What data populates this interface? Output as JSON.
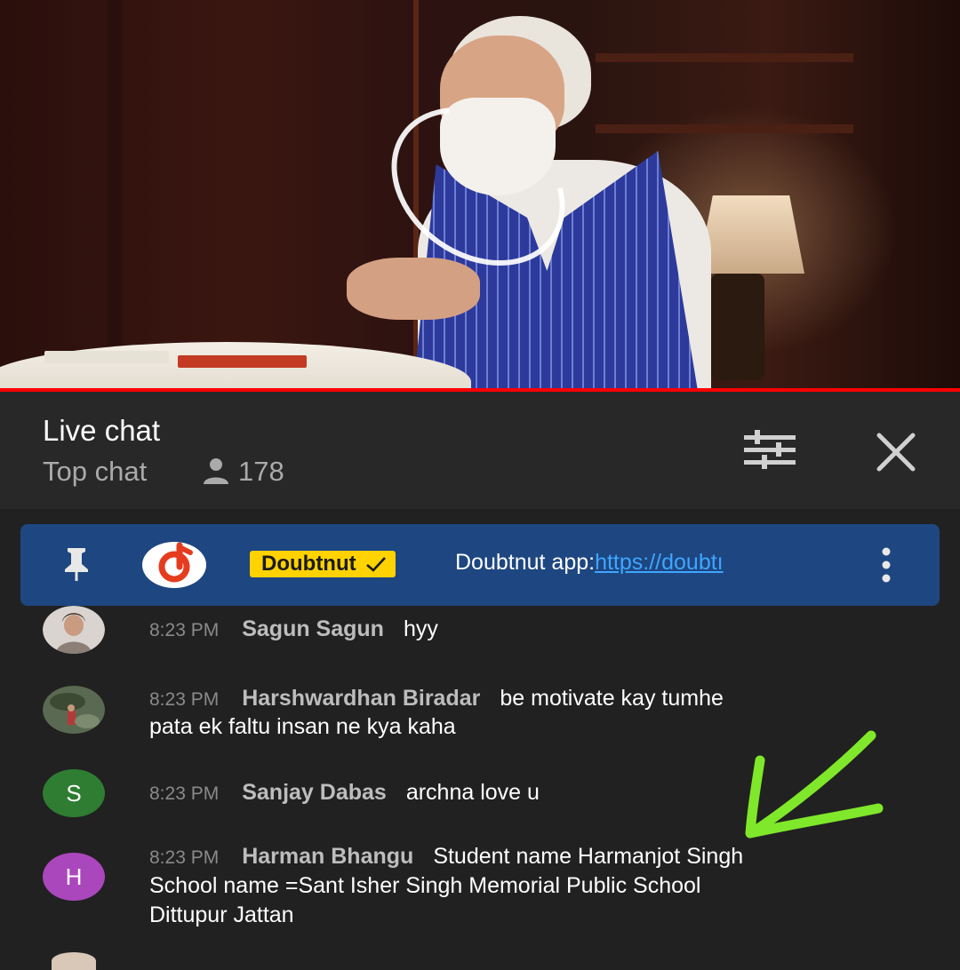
{
  "chat": {
    "title": "Live chat",
    "mode": "Top chat",
    "viewer_count": "178"
  },
  "pinned": {
    "author": "Doubtnut",
    "text_prefix": "Doubtnut app:",
    "link_text": "https://doubtı"
  },
  "messages": [
    {
      "time": "8:23 PM",
      "author": "Sagun Sagun",
      "text": "hyy",
      "avatar_letter": "",
      "avatar_color": "#d9d4cf"
    },
    {
      "time": "8:23 PM",
      "author": "Harshwardhan Biradar",
      "text": "be motivate kay tumhe",
      "text2": "pata ek faltu insan ne kya kaha",
      "avatar_letter": "",
      "avatar_color": "#5a6a52"
    },
    {
      "time": "8:23 PM",
      "author": "Sanjay Dabas",
      "text": "archna love u",
      "avatar_letter": "S",
      "avatar_color": "#2e7d32"
    },
    {
      "time": "8:23 PM",
      "author": "Harman Bhangu",
      "text": "Student name Harmanjot Singh",
      "text2": "School name =Sant Isher Singh Memorial Public School",
      "text3": "Dittupur Jattan",
      "avatar_letter": "H",
      "avatar_color": "#ab47bc"
    }
  ],
  "colors": {
    "progress": "#ff0000",
    "pinned_bg": "#1e4680",
    "badge": "#ffd200",
    "link": "#3ea6ff",
    "arrow": "#7fe82a"
  }
}
